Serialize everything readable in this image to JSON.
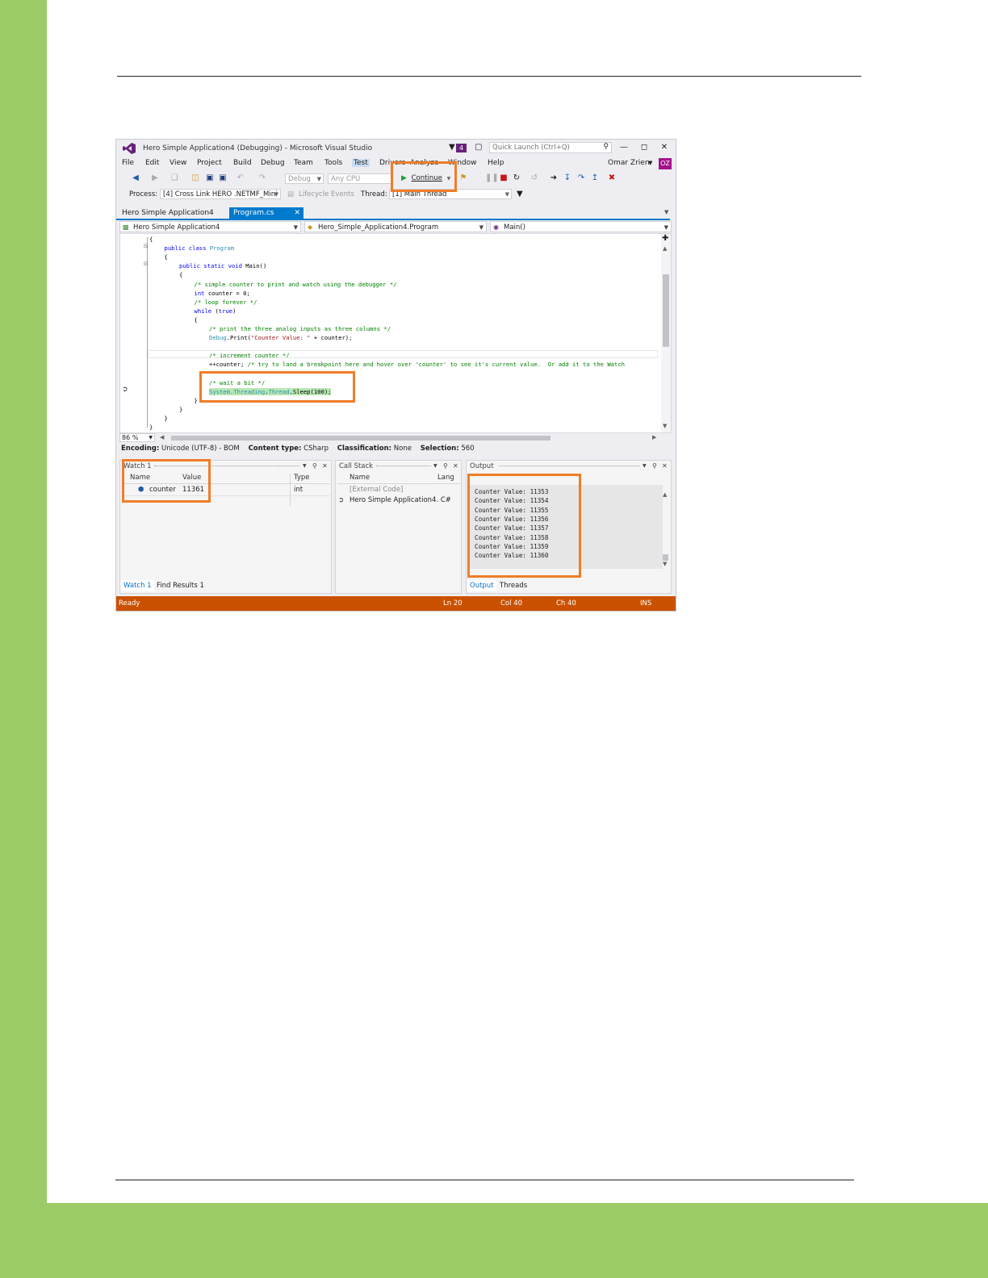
{
  "window": {
    "title": "Hero Simple Application4 (Debugging) - Microsoft Visual Studio",
    "notification_count": "4",
    "quick_launch_placeholder": "Quick Launch (Ctrl+Q)",
    "user_name": "Omar Zrien",
    "user_initials": "OZ"
  },
  "menu": [
    "File",
    "Edit",
    "View",
    "Project",
    "Build",
    "Debug",
    "Team",
    "Tools",
    "Test",
    "Drivers",
    "Analyze",
    "Window",
    "Help"
  ],
  "toolbar": {
    "config": "Debug",
    "platform": "Any CPU",
    "continue_label": "Continue",
    "process_label": "Process:",
    "process_value": "[4] Cross Link HERO .NETMF_Mini",
    "lifecycle_label": "Lifecycle Events",
    "thread_label": "Thread:",
    "thread_value": "[1] Main Thread"
  },
  "tabs": {
    "solution": "Hero Simple Application4",
    "file": "Program.cs"
  },
  "navbar": {
    "project": "Hero Simple Application4",
    "class": "Hero_Simple_Application4.Program",
    "member": "Main()"
  },
  "code": [
    {
      "indent": 0,
      "parts": [
        {
          "t": "{",
          "c": ""
        }
      ]
    },
    {
      "indent": 1,
      "parts": [
        {
          "t": "public class ",
          "c": "kw"
        },
        {
          "t": "Program",
          "c": "ty"
        }
      ]
    },
    {
      "indent": 1,
      "parts": [
        {
          "t": "{",
          "c": ""
        }
      ]
    },
    {
      "indent": 2,
      "parts": [
        {
          "t": "public static void ",
          "c": "kw"
        },
        {
          "t": "Main()",
          "c": ""
        }
      ]
    },
    {
      "indent": 2,
      "parts": [
        {
          "t": "{",
          "c": ""
        }
      ]
    },
    {
      "indent": 3,
      "parts": [
        {
          "t": "/* simple counter to print and watch using the debugger */",
          "c": "cm"
        }
      ]
    },
    {
      "indent": 3,
      "parts": [
        {
          "t": "int ",
          "c": "kw"
        },
        {
          "t": "counter = 0;",
          "c": ""
        }
      ]
    },
    {
      "indent": 3,
      "parts": [
        {
          "t": "/* loop forever */",
          "c": "cm"
        }
      ]
    },
    {
      "indent": 3,
      "parts": [
        {
          "t": "while ",
          "c": "kw"
        },
        {
          "t": "(",
          "c": ""
        },
        {
          "t": "true",
          "c": "kw"
        },
        {
          "t": ")",
          "c": ""
        }
      ]
    },
    {
      "indent": 3,
      "parts": [
        {
          "t": "{",
          "c": ""
        }
      ]
    },
    {
      "indent": 4,
      "parts": [
        {
          "t": "/* print the three analog inputs as three columns */",
          "c": "cm"
        }
      ]
    },
    {
      "indent": 4,
      "parts": [
        {
          "t": "Debug",
          "c": "ty"
        },
        {
          "t": ".Print(",
          "c": ""
        },
        {
          "t": "\"Counter Value: \"",
          "c": "st"
        },
        {
          "t": " + counter);",
          "c": ""
        }
      ]
    },
    {
      "indent": 4,
      "parts": [
        {
          "t": "",
          "c": ""
        }
      ]
    },
    {
      "indent": 4,
      "parts": [
        {
          "t": "/* increment counter */",
          "c": "cm"
        }
      ]
    },
    {
      "indent": 4,
      "parts": [
        {
          "t": "++counter; ",
          "c": ""
        },
        {
          "t": "/* try to land a breakpoint here and hover over 'counter' to see it's current value.  Or add it to the Watch",
          "c": "cm"
        }
      ]
    },
    {
      "indent": 4,
      "parts": [
        {
          "t": "",
          "c": ""
        }
      ]
    },
    {
      "indent": 4,
      "parts": [
        {
          "t": "/* wait a bit */",
          "c": "cm"
        }
      ]
    },
    {
      "indent": 4,
      "parts": [
        {
          "t": "System.Threading",
          "c": "ty hl"
        },
        {
          "t": ".",
          "c": "hl"
        },
        {
          "t": "Thread",
          "c": "ty hl"
        },
        {
          "t": ".Sleep(100);",
          "c": "hl"
        }
      ]
    },
    {
      "indent": 3,
      "parts": [
        {
          "t": "}",
          "c": ""
        }
      ]
    },
    {
      "indent": 2,
      "parts": [
        {
          "t": "}",
          "c": ""
        }
      ]
    },
    {
      "indent": 1,
      "parts": [
        {
          "t": "}",
          "c": ""
        }
      ]
    },
    {
      "indent": 0,
      "parts": [
        {
          "t": "}",
          "c": ""
        }
      ]
    }
  ],
  "editor": {
    "zoom": "86 %"
  },
  "status_info": {
    "encoding_label": "Encoding:",
    "encoding_value": "Unicode (UTF-8) - BOM",
    "content_label": "Content type:",
    "content_value": "CSharp",
    "class_label": "Classification:",
    "class_value": "None",
    "sel_label": "Selection:",
    "sel_value": "560"
  },
  "watch": {
    "title": "Watch 1",
    "col_name": "Name",
    "col_value": "Value",
    "col_type": "Type",
    "row_name": "counter",
    "row_value": "11361",
    "row_type": "int",
    "tab1": "Watch 1",
    "tab2": "Find Results 1"
  },
  "callstack": {
    "title": "Call Stack",
    "col_name": "Name",
    "col_lang": "Lang",
    "row1": "[External Code]",
    "row2": "Hero Simple Application4. C#"
  },
  "output": {
    "title": "Output",
    "lines": [
      "Counter Value: 11353",
      "Counter Value: 11354",
      "Counter Value: 11355",
      "Counter Value: 11356",
      "Counter Value: 11357",
      "Counter Value: 11358",
      "Counter Value: 11359",
      "Counter Value: 11360"
    ],
    "tab1": "Output",
    "tab2": "Threads"
  },
  "statusbar": {
    "ready": "Ready",
    "ln": "Ln 20",
    "col": "Col 40",
    "ch": "Ch 40",
    "ins": "INS"
  },
  "colors": {
    "page_green": "#9bcb66",
    "highlight_orange": "#f07d28",
    "status_orange": "#ca5100",
    "vs_blue": "#007acc"
  }
}
